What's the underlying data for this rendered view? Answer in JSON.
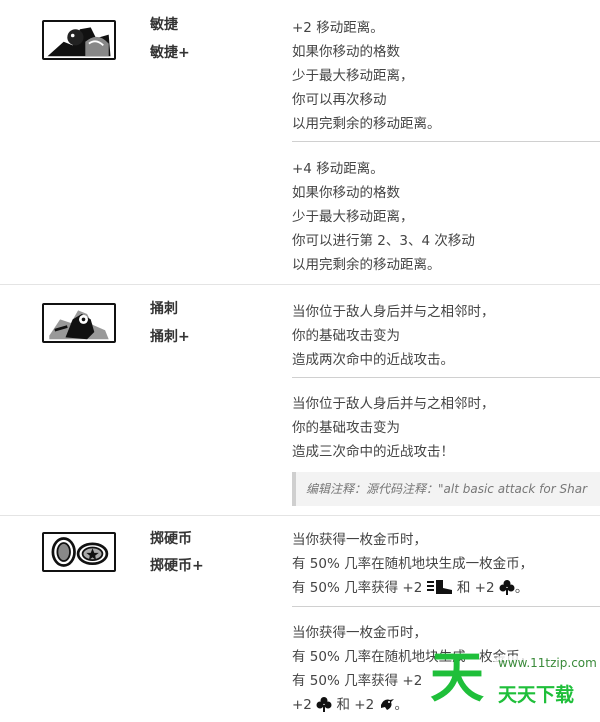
{
  "skills": [
    {
      "name": "敏捷",
      "name_plus": "敏捷+",
      "icon": "agility-icon",
      "base": [
        "+2 移动距离。",
        "如果你移动的格数",
        "少于最大移动距离，",
        "你可以再次移动",
        "以用完剩余的移动距离。"
      ],
      "upgraded": [
        "+4 移动距离。",
        "如果你移动的格数",
        "少于最大移动距离，",
        "你可以进行第 2、3、4 次移动",
        "以用完剩余的移动距离。"
      ]
    },
    {
      "name": "捅刺",
      "name_plus": "捅刺+",
      "icon": "backstab-icon",
      "base": [
        "当你位于敌人身后并与之相邻时，",
        "你的基础攻击变为",
        "造成两次命中的近战攻击。"
      ],
      "upgraded": [
        "当你位于敌人身后并与之相邻时，",
        "你的基础攻击变为",
        "造成三次命中的近战攻击！"
      ],
      "note": "编辑注释：源代码注释：\"alt basic attack for Shar"
    },
    {
      "name": "掷硬币",
      "name_plus": "掷硬币+",
      "icon": "coin-toss-icon",
      "base": [
        "当你获得一枚金币时，",
        "有 50% 几率在随机地块生成一枚金币，"
      ],
      "base_last_prefix": "有 50% 几率获得 +2",
      "base_last_mid": "和 +2",
      "base_last_suffix": "。",
      "upgraded": [
        "当你获得一枚金币时，",
        "有 50% 几率在随机地块生成一枚金币，"
      ],
      "upgraded_line3": "有 50% 几率获得 +2",
      "upgraded_line4_prefix": "+2",
      "upgraded_line4_mid": "和 +2",
      "upgraded_line4_suffix": "。"
    }
  ],
  "watermark": {
    "logo": "天",
    "url": "www.11tzip.com",
    "text": "天天下载"
  }
}
